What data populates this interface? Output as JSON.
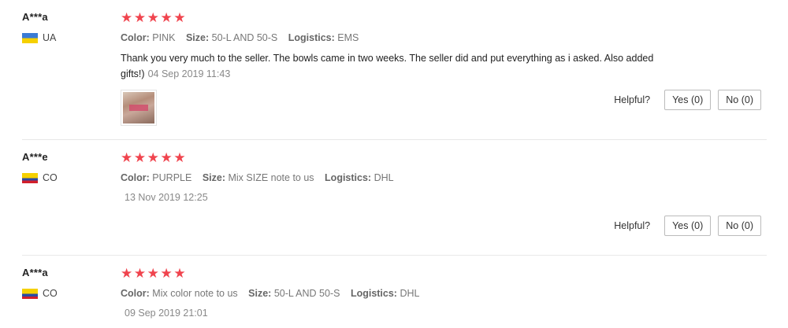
{
  "labels": {
    "color": "Color:",
    "size": "Size:",
    "logistics": "Logistics:",
    "helpful": "Helpful?",
    "yes": "Yes (0)",
    "no": "No (0)"
  },
  "reviews": [
    {
      "user": "A***a",
      "country": "UA",
      "stars": "★★★★★",
      "rating": 5,
      "color": "PINK",
      "size": "50-L AND 50-S",
      "logistics": "EMS",
      "text": "Thank you very much to the seller. The bowls came in two weeks. The seller did and put everything as i asked. Also added gifts!)",
      "date": "04 Sep 2019 11:43"
    },
    {
      "user": "A***e",
      "country": "CO",
      "stars": "★★★★★",
      "rating": 5,
      "color": "PURPLE",
      "size": "Mix SIZE note to us",
      "logistics": "DHL",
      "date": "13 Nov 2019 12:25"
    },
    {
      "user": "A***a",
      "country": "CO",
      "stars": "★★★★★",
      "rating": 5,
      "color": "Mix color note to us",
      "size": "50-L AND 50-S",
      "logistics": "DHL",
      "date": "09 Sep 2019 21:01"
    }
  ],
  "colors": {
    "stars": "#f0444e",
    "divider": "#e8e8e8"
  }
}
